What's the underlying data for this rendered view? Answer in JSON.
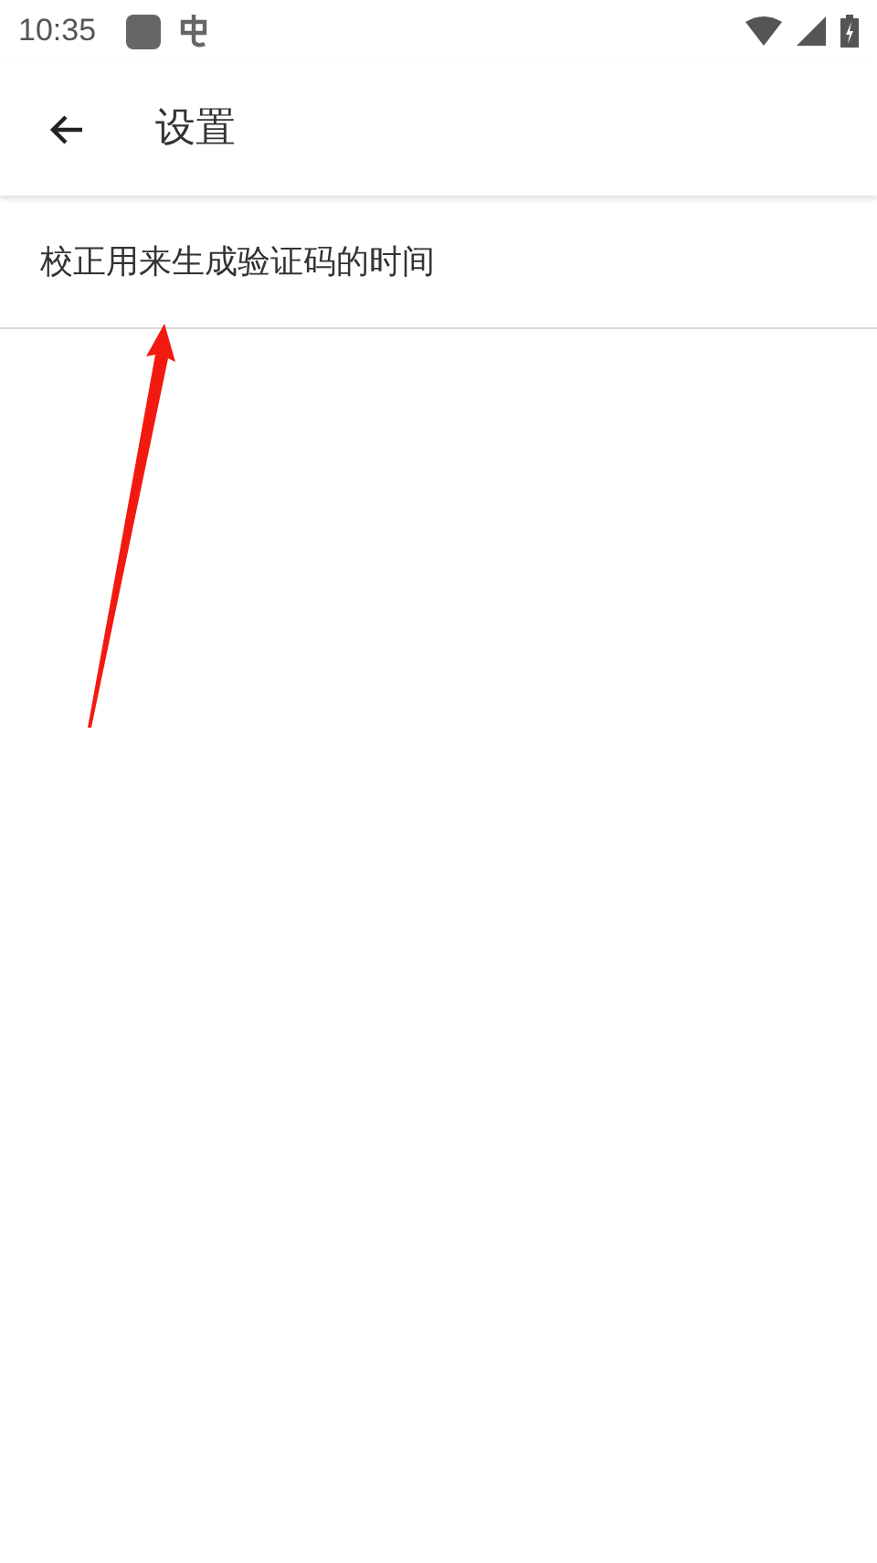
{
  "status_bar": {
    "time": "10:35"
  },
  "toolbar": {
    "title": "设置"
  },
  "settings_items": [
    {
      "label": "校正用来生成验证码的时间"
    }
  ]
}
